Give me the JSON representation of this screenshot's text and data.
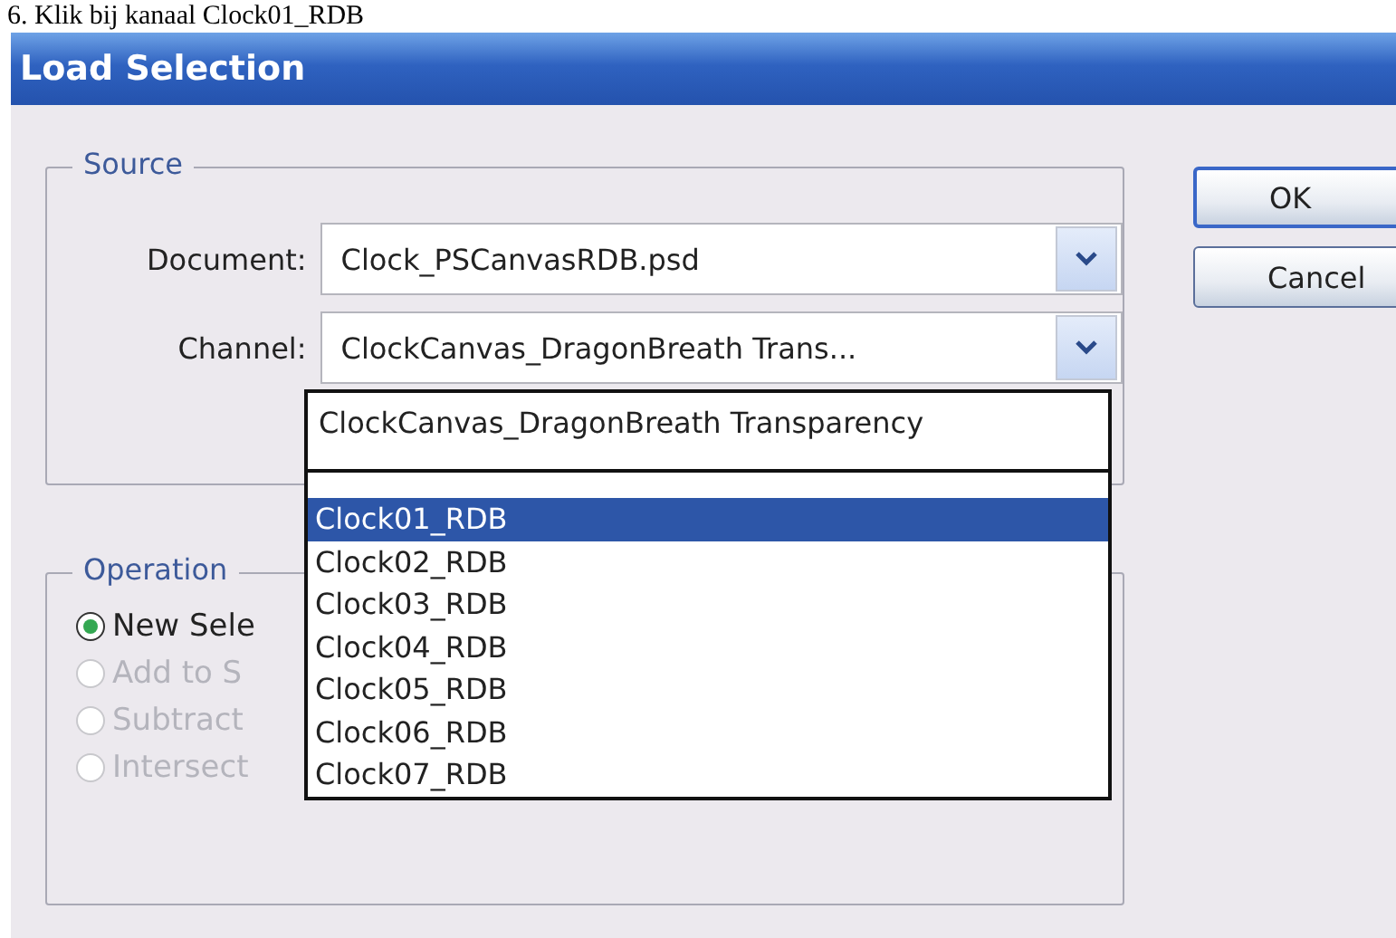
{
  "caption": "6.  Klik bij kanaal Clock01_RDB",
  "window": {
    "title": "Load Selection"
  },
  "source": {
    "label": "Source",
    "fields": [
      {
        "label": "Document:",
        "value": "Clock_PSCanvasRDB.psd"
      },
      {
        "label": "Channel:",
        "value": "ClockCanvas_DragonBreath Trans..."
      }
    ]
  },
  "dropdown": {
    "header": "ClockCanvas_DragonBreath Transparency",
    "items": [
      {
        "label": "Clock01_RDB",
        "selected": true
      },
      {
        "label": "Clock02_RDB",
        "selected": false
      },
      {
        "label": "Clock03_RDB",
        "selected": false
      },
      {
        "label": "Clock04_RDB",
        "selected": false
      },
      {
        "label": "Clock05_RDB",
        "selected": false
      },
      {
        "label": "Clock06_RDB",
        "selected": false
      },
      {
        "label": "Clock07_RDB",
        "selected": false
      }
    ]
  },
  "operation": {
    "label": "Operation",
    "options": [
      {
        "label": "New Sele",
        "selected": true,
        "disabled": false
      },
      {
        "label": "Add to S",
        "selected": false,
        "disabled": true
      },
      {
        "label": "Subtract",
        "selected": false,
        "disabled": true
      },
      {
        "label": "Intersect",
        "selected": false,
        "disabled": true
      }
    ]
  },
  "buttons": [
    {
      "label": "OK",
      "default": true
    },
    {
      "label": "Cancel",
      "default": false
    }
  ]
}
